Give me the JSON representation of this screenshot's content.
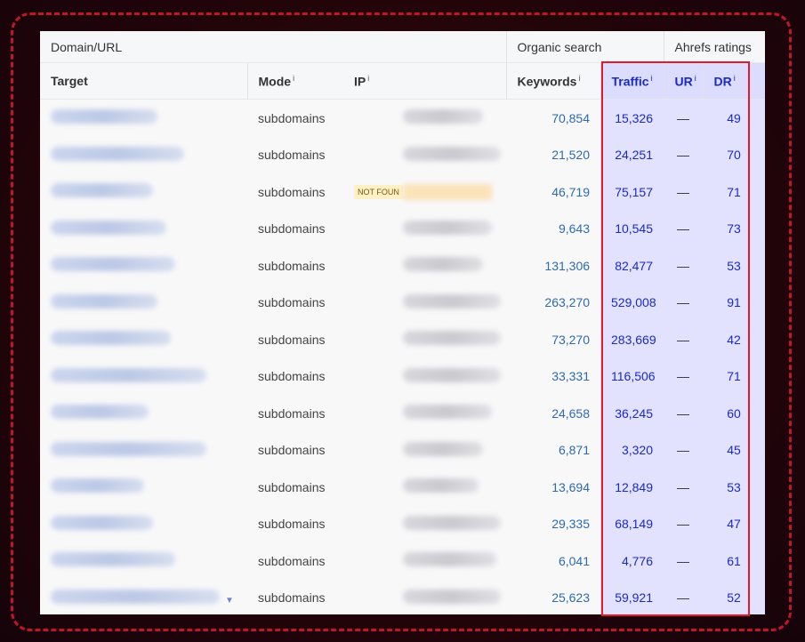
{
  "header": {
    "group_domain": "Domain/URL",
    "group_organic": "Organic search",
    "group_ratings": "Ahrefs ratings",
    "col_target": "Target",
    "col_mode": "Mode",
    "col_ip": "IP",
    "col_keywords": "Keywords",
    "col_traffic": "Traffic",
    "col_ur": "UR",
    "col_dr": "DR",
    "info_mark": "i"
  },
  "not_found_label": "NOT FOUN",
  "rows": [
    {
      "mode": "subdomains",
      "keywords": "70,854",
      "traffic": "15,326",
      "ur": "—",
      "dr": "49"
    },
    {
      "mode": "subdomains",
      "keywords": "21,520",
      "traffic": "24,251",
      "ur": "—",
      "dr": "70"
    },
    {
      "mode": "subdomains",
      "keywords": "46,719",
      "traffic": "75,157",
      "ur": "—",
      "dr": "71"
    },
    {
      "mode": "subdomains",
      "keywords": "9,643",
      "traffic": "10,545",
      "ur": "—",
      "dr": "73"
    },
    {
      "mode": "subdomains",
      "keywords": "131,306",
      "traffic": "82,477",
      "ur": "—",
      "dr": "53"
    },
    {
      "mode": "subdomains",
      "keywords": "263,270",
      "traffic": "529,008",
      "ur": "—",
      "dr": "91"
    },
    {
      "mode": "subdomains",
      "keywords": "73,270",
      "traffic": "283,669",
      "ur": "—",
      "dr": "42"
    },
    {
      "mode": "subdomains",
      "keywords": "33,331",
      "traffic": "116,506",
      "ur": "—",
      "dr": "71"
    },
    {
      "mode": "subdomains",
      "keywords": "24,658",
      "traffic": "36,245",
      "ur": "—",
      "dr": "60"
    },
    {
      "mode": "subdomains",
      "keywords": "6,871",
      "traffic": "3,320",
      "ur": "—",
      "dr": "45"
    },
    {
      "mode": "subdomains",
      "keywords": "13,694",
      "traffic": "12,849",
      "ur": "—",
      "dr": "53"
    },
    {
      "mode": "subdomains",
      "keywords": "29,335",
      "traffic": "68,149",
      "ur": "—",
      "dr": "47"
    },
    {
      "mode": "subdomains",
      "keywords": "6,041",
      "traffic": "4,776",
      "ur": "—",
      "dr": "61"
    },
    {
      "mode": "subdomains",
      "keywords": "25,623",
      "traffic": "59,921",
      "ur": "—",
      "dr": "52"
    }
  ],
  "colors": {
    "highlight_border": "#e21a2c",
    "traffic_text": "#1a2bc4",
    "keywords_text": "#2e6ab0",
    "frame_dash": "#c0162a"
  }
}
